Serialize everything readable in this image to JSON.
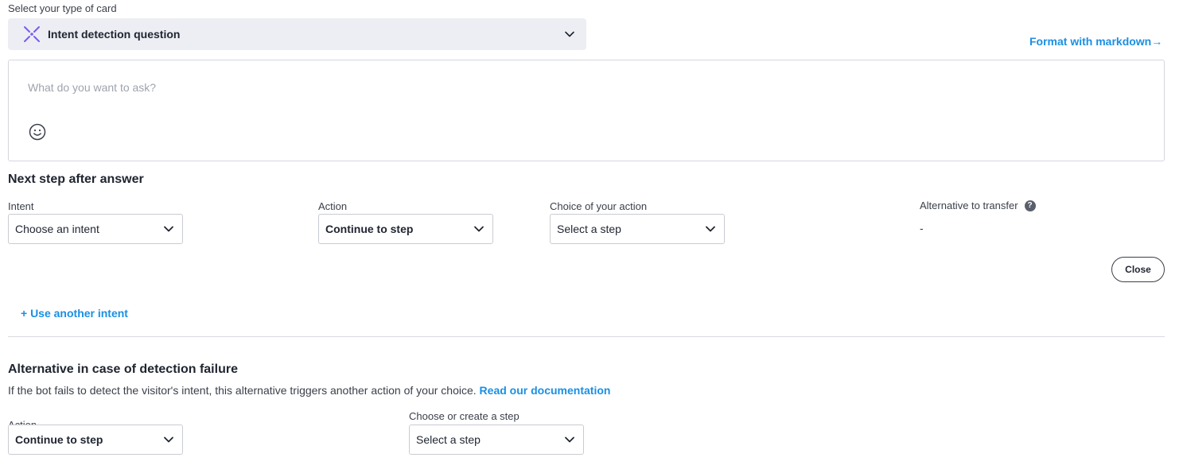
{
  "card_type": {
    "label": "Select your type of card",
    "selected": "Intent detection question",
    "icon": "intent-detection-icon",
    "accent": "#7b5cf0"
  },
  "format_link": "Format with markdown→",
  "editor": {
    "placeholder": "What do you want to ask?",
    "emoji_icon": "emoji-icon"
  },
  "next_step": {
    "title": "Next step after answer",
    "intent": {
      "label": "Intent",
      "value": "Choose an intent"
    },
    "action": {
      "label": "Action",
      "value": "Continue to step"
    },
    "choice": {
      "label": "Choice of your action",
      "value": "Select a step"
    },
    "alternative": {
      "label": "Alternative to transfer",
      "help": "?",
      "value": "-"
    },
    "close_label": "Close",
    "add_intent": "+ Use another intent"
  },
  "failure": {
    "title": "Alternative in case of detection failure",
    "description": "If the bot fails to detect the visitor's intent, this alternative triggers another action of your choice.",
    "doc_link": "Read our documentation",
    "action": {
      "label": "Action",
      "value": "Continue to step"
    },
    "step": {
      "label": "Choose or create a step",
      "value": "Select a step"
    }
  },
  "colors": {
    "link": "#1a8fe3",
    "text": "#1f2430",
    "muted": "#9ea3ad"
  }
}
